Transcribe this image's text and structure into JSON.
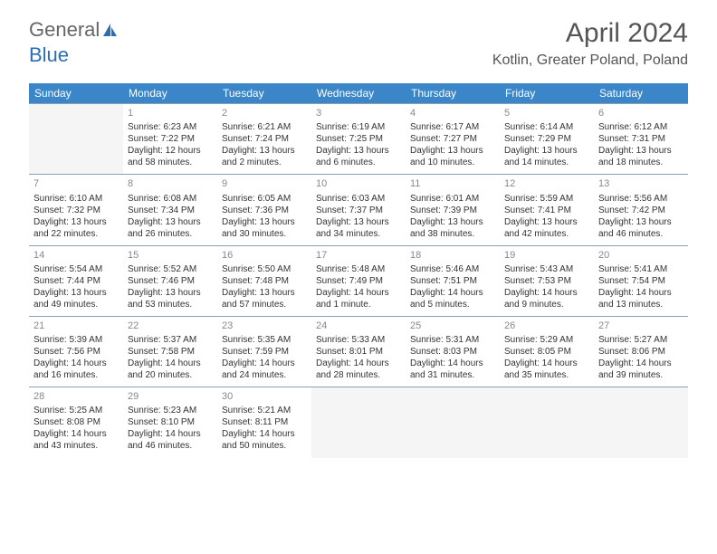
{
  "logo_text_1": "General",
  "logo_text_2": "Blue",
  "title": "April 2024",
  "location": "Kotlin, Greater Poland, Poland",
  "day_headers": [
    "Sunday",
    "Monday",
    "Tuesday",
    "Wednesday",
    "Thursday",
    "Friday",
    "Saturday"
  ],
  "weeks": [
    [
      null,
      {
        "n": "1",
        "sr": "Sunrise: 6:23 AM",
        "ss": "Sunset: 7:22 PM",
        "d1": "Daylight: 12 hours",
        "d2": "and 58 minutes."
      },
      {
        "n": "2",
        "sr": "Sunrise: 6:21 AM",
        "ss": "Sunset: 7:24 PM",
        "d1": "Daylight: 13 hours",
        "d2": "and 2 minutes."
      },
      {
        "n": "3",
        "sr": "Sunrise: 6:19 AM",
        "ss": "Sunset: 7:25 PM",
        "d1": "Daylight: 13 hours",
        "d2": "and 6 minutes."
      },
      {
        "n": "4",
        "sr": "Sunrise: 6:17 AM",
        "ss": "Sunset: 7:27 PM",
        "d1": "Daylight: 13 hours",
        "d2": "and 10 minutes."
      },
      {
        "n": "5",
        "sr": "Sunrise: 6:14 AM",
        "ss": "Sunset: 7:29 PM",
        "d1": "Daylight: 13 hours",
        "d2": "and 14 minutes."
      },
      {
        "n": "6",
        "sr": "Sunrise: 6:12 AM",
        "ss": "Sunset: 7:31 PM",
        "d1": "Daylight: 13 hours",
        "d2": "and 18 minutes."
      }
    ],
    [
      {
        "n": "7",
        "sr": "Sunrise: 6:10 AM",
        "ss": "Sunset: 7:32 PM",
        "d1": "Daylight: 13 hours",
        "d2": "and 22 minutes."
      },
      {
        "n": "8",
        "sr": "Sunrise: 6:08 AM",
        "ss": "Sunset: 7:34 PM",
        "d1": "Daylight: 13 hours",
        "d2": "and 26 minutes."
      },
      {
        "n": "9",
        "sr": "Sunrise: 6:05 AM",
        "ss": "Sunset: 7:36 PM",
        "d1": "Daylight: 13 hours",
        "d2": "and 30 minutes."
      },
      {
        "n": "10",
        "sr": "Sunrise: 6:03 AM",
        "ss": "Sunset: 7:37 PM",
        "d1": "Daylight: 13 hours",
        "d2": "and 34 minutes."
      },
      {
        "n": "11",
        "sr": "Sunrise: 6:01 AM",
        "ss": "Sunset: 7:39 PM",
        "d1": "Daylight: 13 hours",
        "d2": "and 38 minutes."
      },
      {
        "n": "12",
        "sr": "Sunrise: 5:59 AM",
        "ss": "Sunset: 7:41 PM",
        "d1": "Daylight: 13 hours",
        "d2": "and 42 minutes."
      },
      {
        "n": "13",
        "sr": "Sunrise: 5:56 AM",
        "ss": "Sunset: 7:42 PM",
        "d1": "Daylight: 13 hours",
        "d2": "and 46 minutes."
      }
    ],
    [
      {
        "n": "14",
        "sr": "Sunrise: 5:54 AM",
        "ss": "Sunset: 7:44 PM",
        "d1": "Daylight: 13 hours",
        "d2": "and 49 minutes."
      },
      {
        "n": "15",
        "sr": "Sunrise: 5:52 AM",
        "ss": "Sunset: 7:46 PM",
        "d1": "Daylight: 13 hours",
        "d2": "and 53 minutes."
      },
      {
        "n": "16",
        "sr": "Sunrise: 5:50 AM",
        "ss": "Sunset: 7:48 PM",
        "d1": "Daylight: 13 hours",
        "d2": "and 57 minutes."
      },
      {
        "n": "17",
        "sr": "Sunrise: 5:48 AM",
        "ss": "Sunset: 7:49 PM",
        "d1": "Daylight: 14 hours",
        "d2": "and 1 minute."
      },
      {
        "n": "18",
        "sr": "Sunrise: 5:46 AM",
        "ss": "Sunset: 7:51 PM",
        "d1": "Daylight: 14 hours",
        "d2": "and 5 minutes."
      },
      {
        "n": "19",
        "sr": "Sunrise: 5:43 AM",
        "ss": "Sunset: 7:53 PM",
        "d1": "Daylight: 14 hours",
        "d2": "and 9 minutes."
      },
      {
        "n": "20",
        "sr": "Sunrise: 5:41 AM",
        "ss": "Sunset: 7:54 PM",
        "d1": "Daylight: 14 hours",
        "d2": "and 13 minutes."
      }
    ],
    [
      {
        "n": "21",
        "sr": "Sunrise: 5:39 AM",
        "ss": "Sunset: 7:56 PM",
        "d1": "Daylight: 14 hours",
        "d2": "and 16 minutes."
      },
      {
        "n": "22",
        "sr": "Sunrise: 5:37 AM",
        "ss": "Sunset: 7:58 PM",
        "d1": "Daylight: 14 hours",
        "d2": "and 20 minutes."
      },
      {
        "n": "23",
        "sr": "Sunrise: 5:35 AM",
        "ss": "Sunset: 7:59 PM",
        "d1": "Daylight: 14 hours",
        "d2": "and 24 minutes."
      },
      {
        "n": "24",
        "sr": "Sunrise: 5:33 AM",
        "ss": "Sunset: 8:01 PM",
        "d1": "Daylight: 14 hours",
        "d2": "and 28 minutes."
      },
      {
        "n": "25",
        "sr": "Sunrise: 5:31 AM",
        "ss": "Sunset: 8:03 PM",
        "d1": "Daylight: 14 hours",
        "d2": "and 31 minutes."
      },
      {
        "n": "26",
        "sr": "Sunrise: 5:29 AM",
        "ss": "Sunset: 8:05 PM",
        "d1": "Daylight: 14 hours",
        "d2": "and 35 minutes."
      },
      {
        "n": "27",
        "sr": "Sunrise: 5:27 AM",
        "ss": "Sunset: 8:06 PM",
        "d1": "Daylight: 14 hours",
        "d2": "and 39 minutes."
      }
    ],
    [
      {
        "n": "28",
        "sr": "Sunrise: 5:25 AM",
        "ss": "Sunset: 8:08 PM",
        "d1": "Daylight: 14 hours",
        "d2": "and 43 minutes."
      },
      {
        "n": "29",
        "sr": "Sunrise: 5:23 AM",
        "ss": "Sunset: 8:10 PM",
        "d1": "Daylight: 14 hours",
        "d2": "and 46 minutes."
      },
      {
        "n": "30",
        "sr": "Sunrise: 5:21 AM",
        "ss": "Sunset: 8:11 PM",
        "d1": "Daylight: 14 hours",
        "d2": "and 50 minutes."
      },
      null,
      null,
      null,
      null
    ]
  ]
}
